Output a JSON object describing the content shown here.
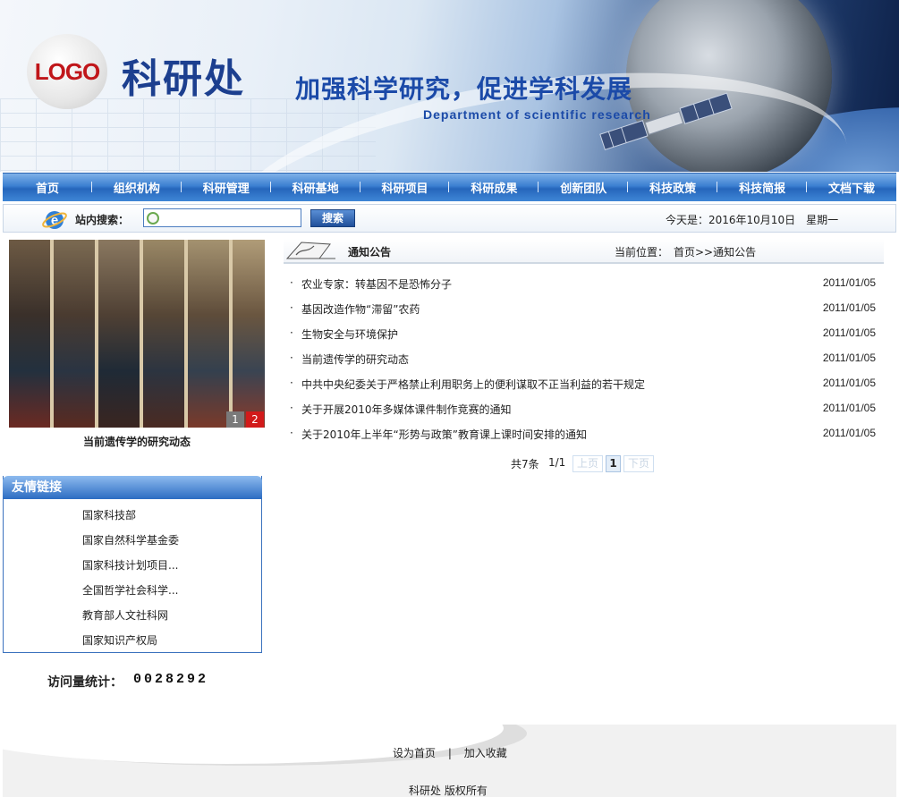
{
  "header": {
    "logo_text": "LOGO",
    "site_title": "科研处",
    "slogan": "加强科学研究，促进学科发展",
    "slogan_en": "Department of scientific research"
  },
  "nav": {
    "items": [
      "首页",
      "组织机构",
      "科研管理",
      "科研基地",
      "科研项目",
      "科研成果",
      "创新团队",
      "科技政策",
      "科技简报",
      "文档下载"
    ]
  },
  "search": {
    "label": "站内搜索：",
    "value": "",
    "button_label": "搜索",
    "date_text": "今天是：2016年10月10日　星期一"
  },
  "slideshow": {
    "page_buttons": [
      "1",
      "2"
    ],
    "caption": "当前遗传学的研究动态"
  },
  "links": {
    "title": "友情链接",
    "items": [
      "国家科技部",
      "国家自然科学基金委",
      "国家科技计划项目...",
      "全国哲学社会科学...",
      "教育部人文社科网",
      "国家知识产权局"
    ]
  },
  "visits": {
    "label": "访问量统计：",
    "count": "0028292"
  },
  "notice": {
    "title": "通知公告",
    "breadcrumb": "当前位置：　首页>>通知公告",
    "bullet": "·",
    "items": [
      {
        "title": "农业专家：转基因不是恐怖分子",
        "date": "2011/01/05"
      },
      {
        "title": "基因改造作物“滞留”农药",
        "date": "2011/01/05"
      },
      {
        "title": "生物安全与环境保护",
        "date": "2011/01/05"
      },
      {
        "title": "当前遗传学的研究动态",
        "date": "2011/01/05"
      },
      {
        "title": "中共中央纪委关于严格禁止利用职务上的便利谋取不正当利益的若干规定",
        "date": "2011/01/05"
      },
      {
        "title": "关于开展2010年多媒体课件制作竞赛的通知",
        "date": "2011/01/05"
      },
      {
        "title": "关于2010年上半年“形势与政策”教育课上课时间安排的通知",
        "date": "2011/01/05"
      }
    ]
  },
  "pager": {
    "total": "共7条",
    "page_info": "1/1",
    "prev": "上页",
    "current": "1",
    "next": "下页"
  },
  "footer": {
    "set_home": "设为首页",
    "separator": "|",
    "add_favorite": "加入收藏",
    "copyright": "科研处  版权所有"
  },
  "colors": {
    "nav_blue": "#2566bb",
    "slide_active_red": "#d21a1a",
    "slide_inactive_gray": "#7a7a7a"
  }
}
